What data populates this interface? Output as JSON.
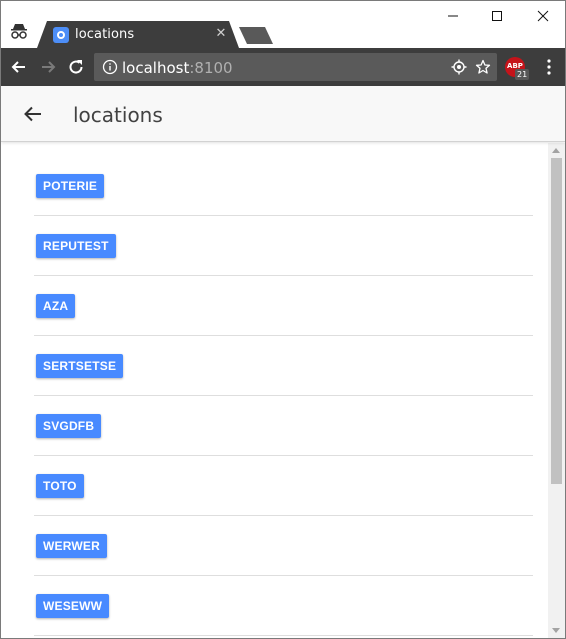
{
  "browser": {
    "tab_title": "locations",
    "tab_close": "✕",
    "url_host": "localhost",
    "url_port": ":8100",
    "extension": {
      "label": "ABP",
      "badge": "21",
      "color": "#c5131a"
    },
    "icons": {
      "incognito": "incognito-icon",
      "back": "arrow-left-icon",
      "forward": "arrow-right-icon",
      "reload": "reload-icon",
      "info": "info-icon",
      "location": "location-target-icon",
      "bookmark": "star-icon",
      "menu": "more-vertical-icon"
    },
    "colors": {
      "toolbar": "#3d3d3d",
      "tab": "#3d3d3d",
      "omnibox": "#5a5a5a"
    }
  },
  "header": {
    "title": "locations",
    "back_icon": "arrow-back-icon"
  },
  "locations": [
    "POTERIE",
    "REPUTEST",
    "AZA",
    "SERTSETSE",
    "SVGDFB",
    "TOTO",
    "WERWER",
    "WESEWW"
  ],
  "colors": {
    "button": "#488aff",
    "header_bg": "#f8f8f8"
  }
}
